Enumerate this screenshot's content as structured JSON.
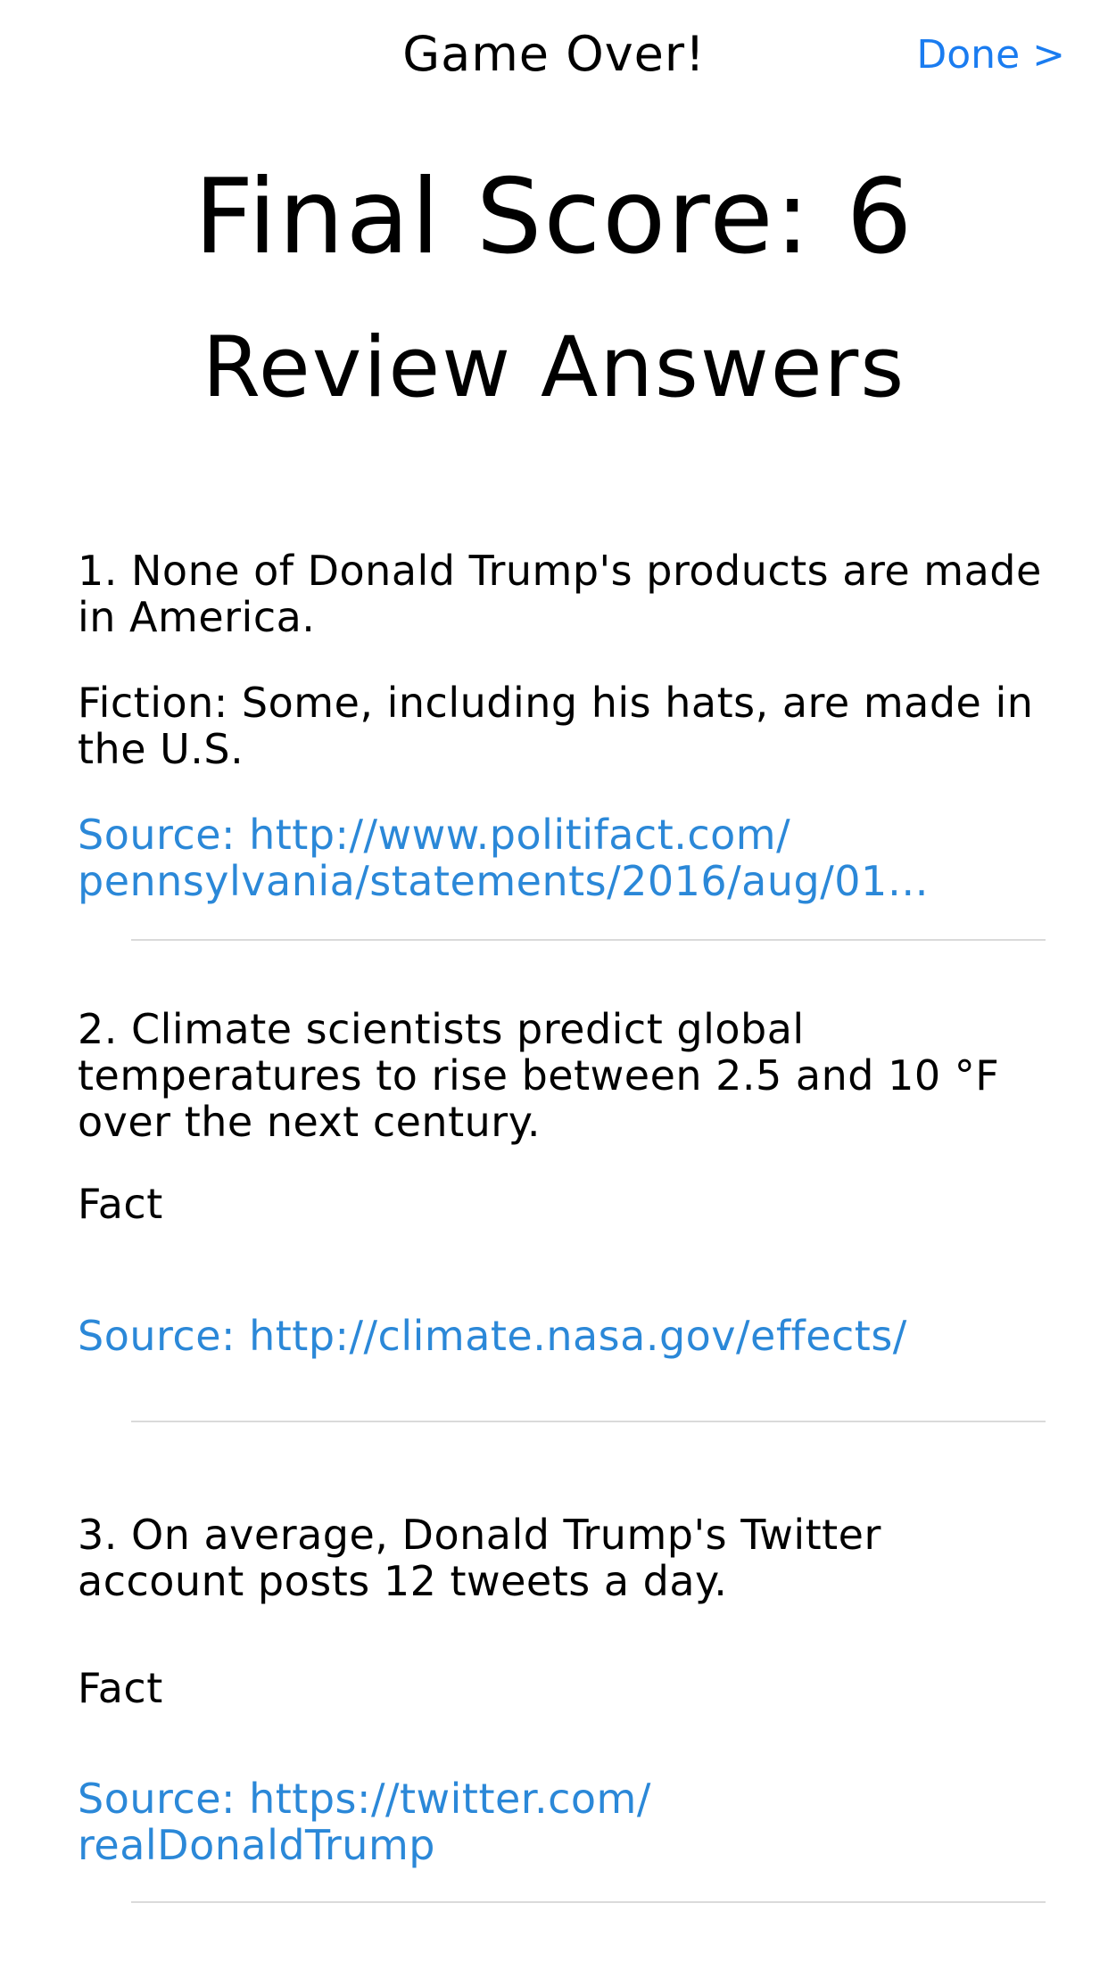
{
  "nav": {
    "title": "Game Over!",
    "done_label": "Done >"
  },
  "score": {
    "label": "Final Score: 6"
  },
  "review": {
    "heading": "Review Answers"
  },
  "answers": [
    {
      "question": "1. None of Donald Trump's products are made in America.",
      "answer": "Fiction: Some, including his hats, are made in the U.S.",
      "source_line1": "Source: http://www.politifact.com/",
      "source_line2": "pennsylvania/statements/2016/aug/01…"
    },
    {
      "question": "2. Climate scientists predict global temperatures to rise between 2.5 and 10 °F over the next century.",
      "answer": "Fact",
      "source_line1": "Source: http://climate.nasa.gov/effects/",
      "source_line2": ""
    },
    {
      "question": "3. On average, Donald Trump's Twitter account posts 12 tweets a day.",
      "answer": "Fact",
      "source_line1": "Source: https://twitter.com/",
      "source_line2": "realDonaldTrump"
    }
  ],
  "colors": {
    "link": "#2b88d8",
    "done": "#1a7cf0",
    "separator": "#dadada"
  }
}
